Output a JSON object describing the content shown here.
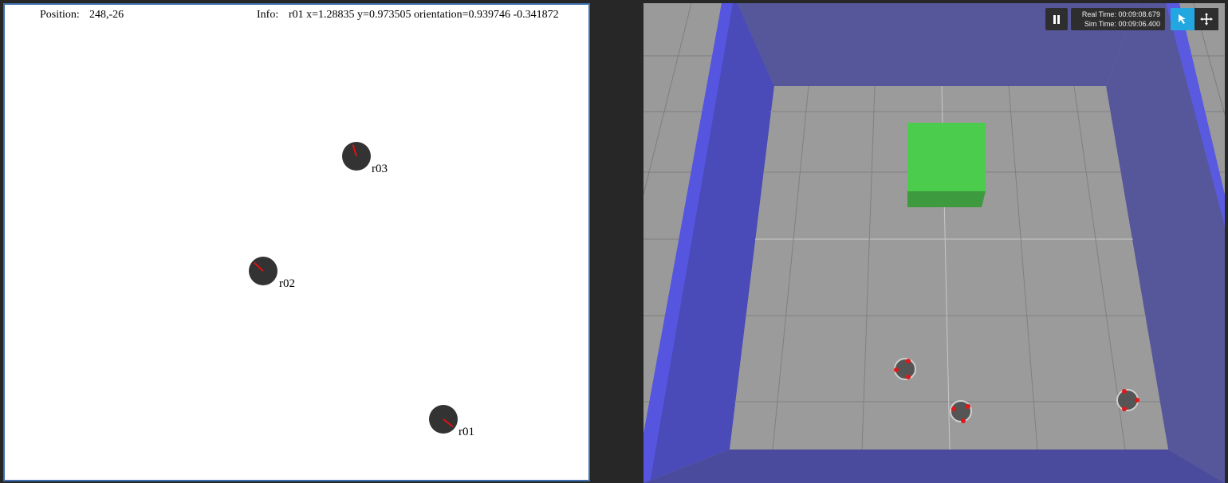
{
  "map": {
    "position_label": "Position:",
    "position_value": "248,-26",
    "info_label": "Info:",
    "info_value": "r01 x=1.28835 y=0.973505 orientation=0.939746 -0.341872",
    "robots": [
      {
        "id": "r03",
        "label": "r03"
      },
      {
        "id": "r02",
        "label": "r02"
      },
      {
        "id": "r01",
        "label": "r01"
      }
    ]
  },
  "sim": {
    "real_time_label": "Real Time:",
    "real_time_value": "00:09:08.679",
    "sim_time_label": "Sim Time:",
    "sim_time_value": "00:09:06.400",
    "controls": {
      "pause_icon": "pause-icon",
      "select_icon": "arrow-cursor-icon",
      "translate_icon": "move-arrows-icon"
    },
    "colors": {
      "wall": "#4a4acc",
      "floor": "#9b9b9b",
      "box": "#4ccc4c",
      "accent": "#23a7e0"
    }
  }
}
